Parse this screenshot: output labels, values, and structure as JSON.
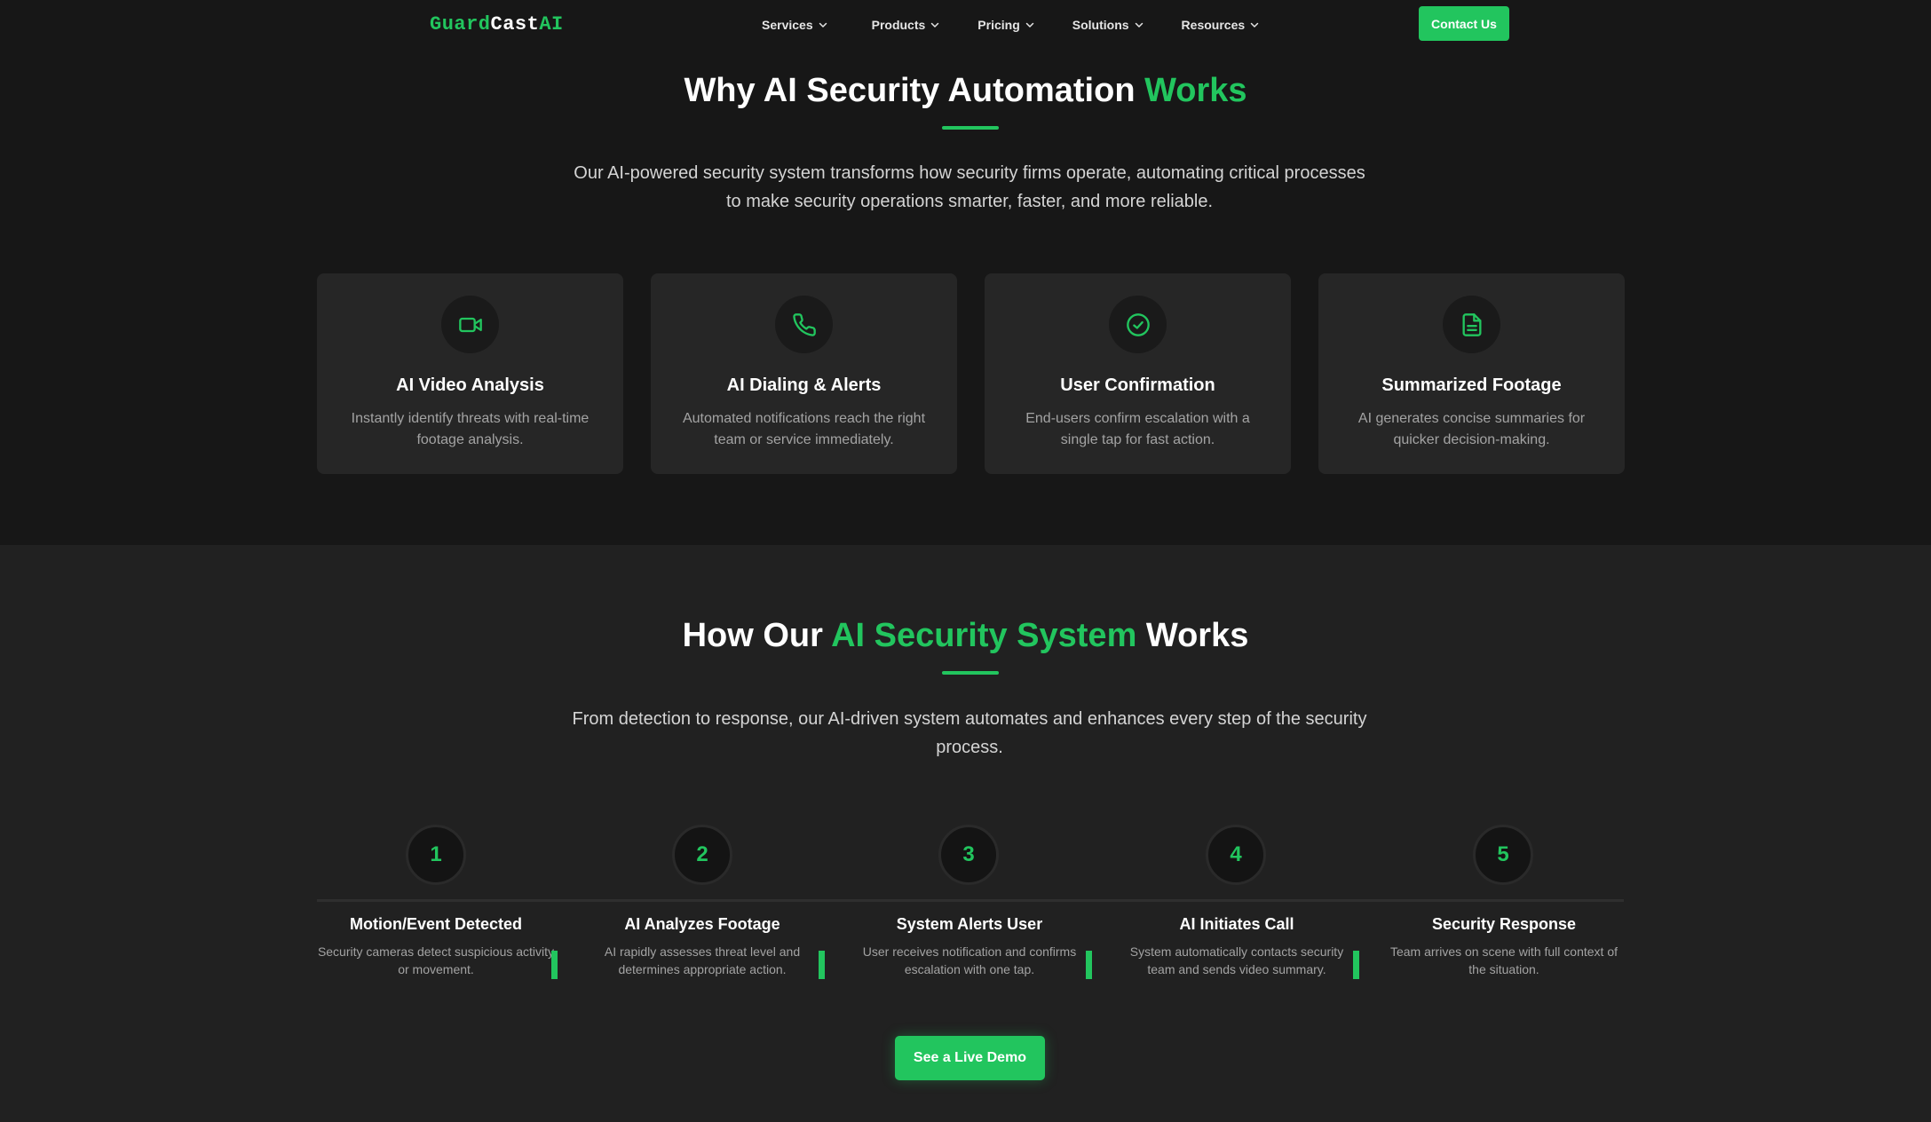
{
  "brand": {
    "logo_part1": "Guard",
    "logo_part2": "Cast",
    "logo_part3": "AI",
    "accent_color": "#22c55e"
  },
  "nav": {
    "items": [
      {
        "label": "Services",
        "icon": "chevron-down-icon"
      },
      {
        "label": "Products",
        "icon": "chevron-down-icon"
      },
      {
        "label": "Pricing",
        "icon": "chevron-down-icon"
      },
      {
        "label": "Solutions",
        "icon": "chevron-down-icon"
      },
      {
        "label": "Resources",
        "icon": "chevron-down-icon"
      }
    ],
    "contact_label": "Contact Us"
  },
  "why": {
    "title_main": "Why AI Security Automation ",
    "title_accent": "Works",
    "description_line1": "Our AI-powered security system transforms how security firms operate, automating critical processes",
    "description_line2": "to make security operations smarter, faster, and more reliable.",
    "features": [
      {
        "icon": "video-camera-icon",
        "title": "AI Video Analysis",
        "text": "Instantly identify threats with real-time footage analysis."
      },
      {
        "icon": "phone-icon",
        "title": "AI Dialing & Alerts",
        "text": "Automated notifications reach the right team or service immediately."
      },
      {
        "icon": "check-circle-icon",
        "title": "User Confirmation",
        "text": "End-users confirm escalation with a single tap for fast action."
      },
      {
        "icon": "document-icon",
        "title": "Summarized Footage",
        "text": "AI generates concise summaries for quicker decision-making."
      }
    ]
  },
  "how": {
    "title_pre": "How Our ",
    "title_accent": "AI Security System",
    "title_post": " Works",
    "description_line1": "From detection to response, our AI-driven system automates and enhances every step of the security",
    "description_line2": "process.",
    "steps": [
      {
        "number": "1",
        "title": "Motion/Event Detected",
        "text": "Security cameras detect suspicious activity or movement."
      },
      {
        "number": "2",
        "title": "AI Analyzes Footage",
        "text": "AI rapidly assesses threat level and determines appropriate action."
      },
      {
        "number": "3",
        "title": "System Alerts User",
        "text": "User receives notification and confirms escalation with one tap."
      },
      {
        "number": "4",
        "title": "AI Initiates Call",
        "text": "System automatically contacts security team and sends video summary."
      },
      {
        "number": "5",
        "title": "Security Response",
        "text": "Team arrives on scene with full context of the situation."
      }
    ],
    "cta_label": "See a Live Demo"
  }
}
